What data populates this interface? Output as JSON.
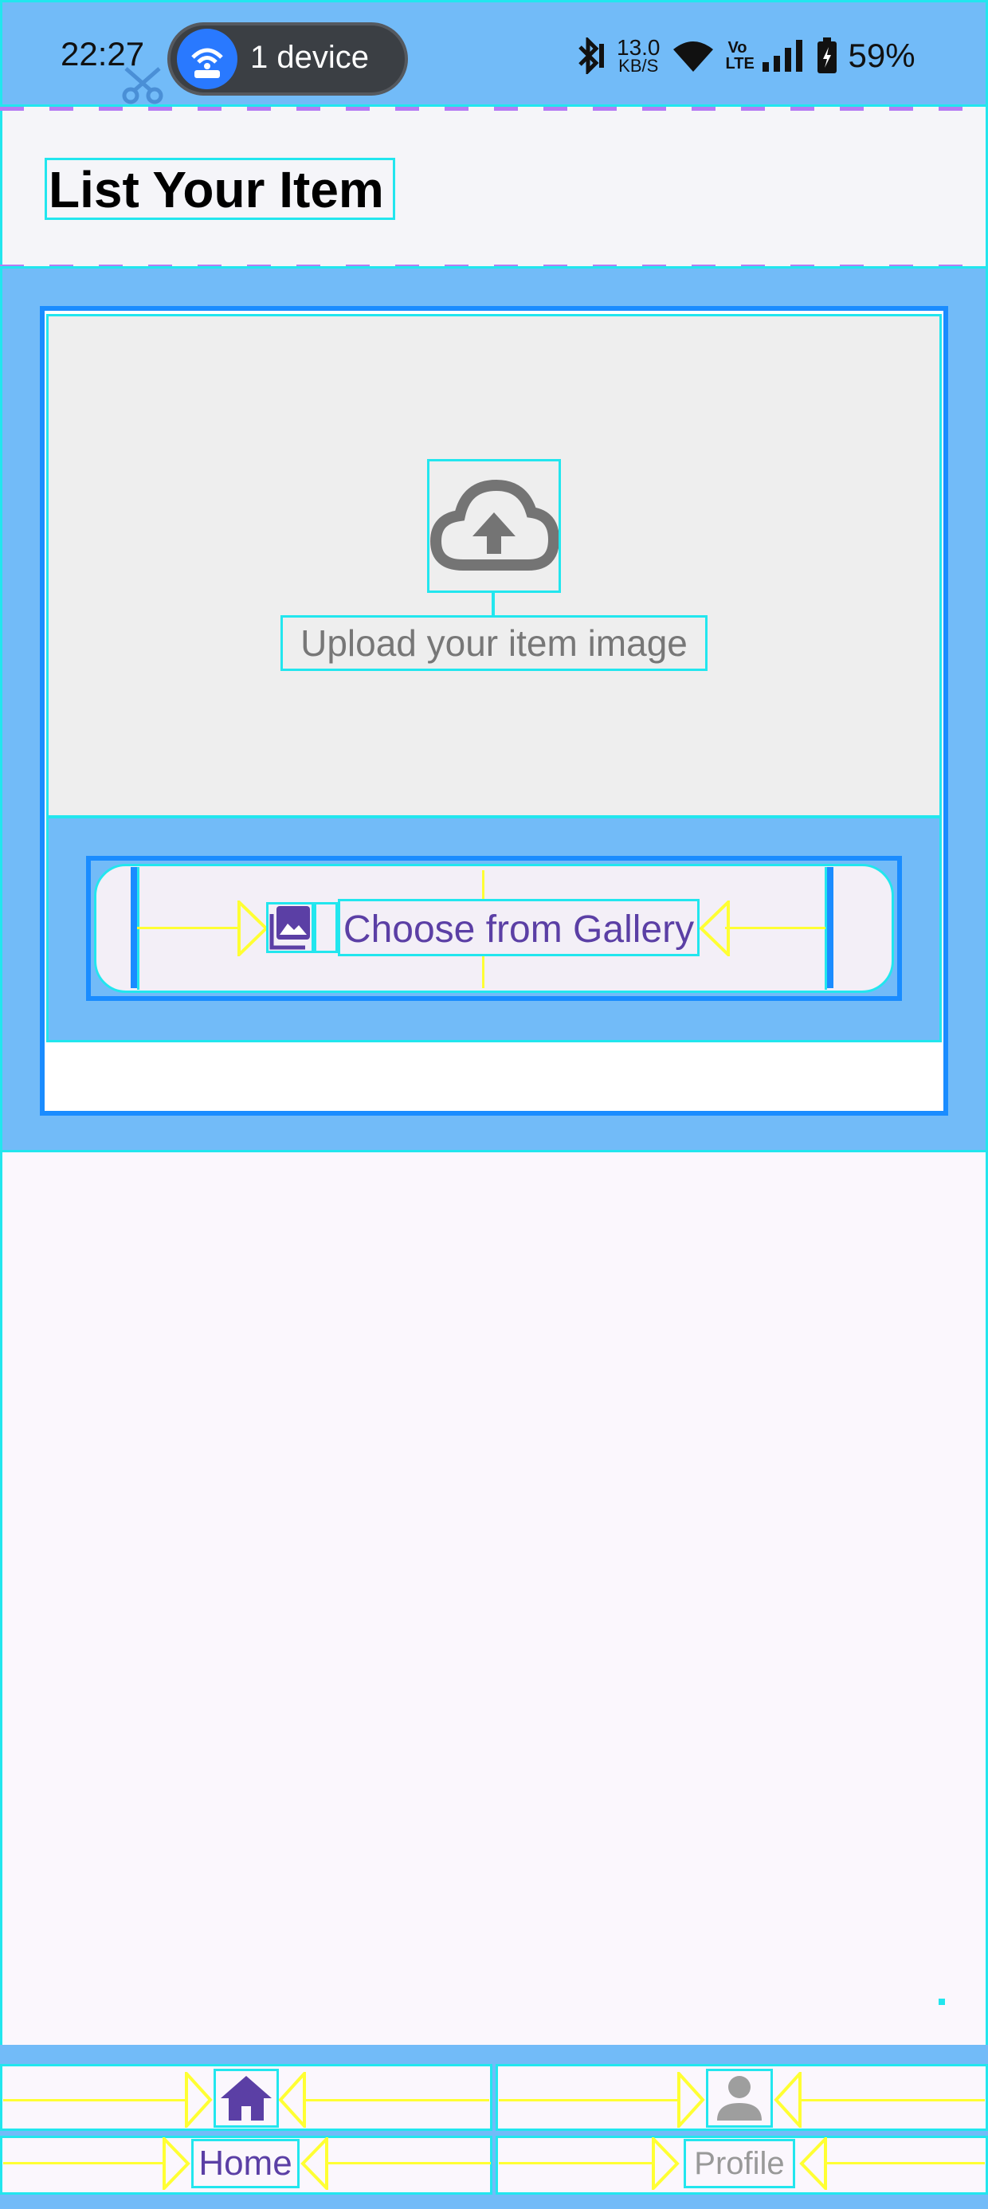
{
  "status_bar": {
    "time": "22:27",
    "device_pill": "1 device",
    "net_speed_value": "13.0",
    "net_speed_unit": "KB/S",
    "volte": "Vo LTE",
    "battery": "59%"
  },
  "header": {
    "title": "List Your Item"
  },
  "upload": {
    "label": "Upload your item image",
    "icon": "cloud-upload-icon"
  },
  "gallery_button": {
    "label": "Choose from Gallery",
    "icon": "photo-library-icon"
  },
  "bottom_nav": {
    "items": [
      {
        "label": "Home",
        "icon": "home-icon",
        "active": true
      },
      {
        "label": "Profile",
        "icon": "person-icon",
        "active": false
      }
    ]
  },
  "colors": {
    "accent": "#5b3fa5",
    "overlay_blue": "#72bbf8",
    "guide_cyan": "#22e6ee",
    "guide_yellow": "#ffff33"
  }
}
